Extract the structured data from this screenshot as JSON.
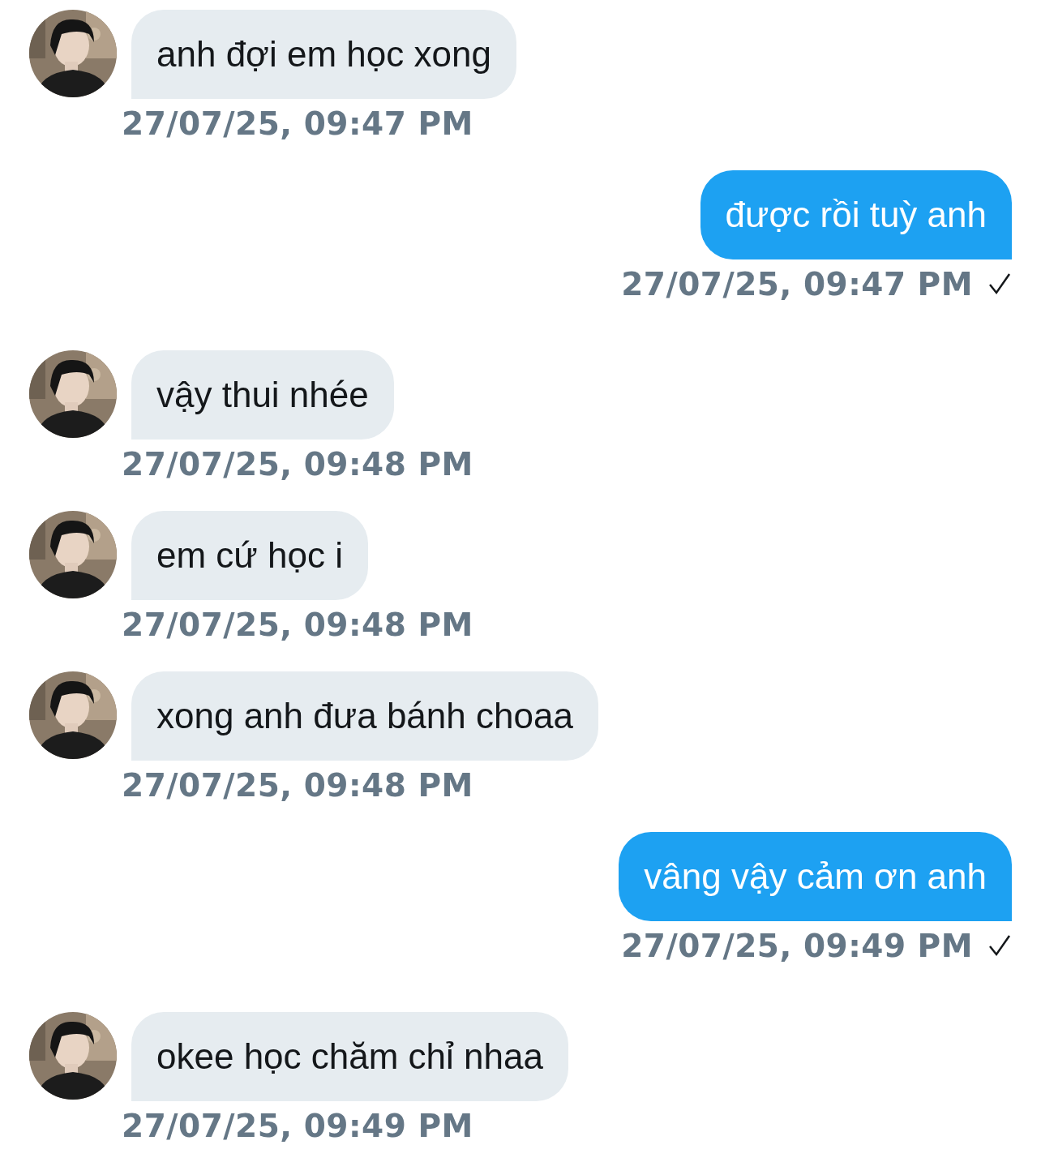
{
  "messages": [
    {
      "kind": "incoming",
      "text": "anh đợi em học xong",
      "time": "27/07/25, 09:47 PM"
    },
    {
      "kind": "outgoing",
      "text": "được rồi tuỳ anh",
      "time": "27/07/25, 09:47 PM",
      "delivered": true
    },
    {
      "kind": "incoming",
      "text": "vậy thui nhée",
      "time": "27/07/25, 09:48 PM"
    },
    {
      "kind": "incoming",
      "text": "em cứ học i",
      "time": "27/07/25, 09:48 PM"
    },
    {
      "kind": "incoming",
      "text": "xong anh đưa bánh choaa",
      "time": "27/07/25, 09:48 PM"
    },
    {
      "kind": "outgoing",
      "text": "vâng vậy cảm ơn anh",
      "time": "27/07/25, 09:49 PM",
      "delivered": true
    },
    {
      "kind": "incoming",
      "text": "okee học chăm chỉ nhaa",
      "time": "27/07/25, 09:49 PM"
    }
  ]
}
